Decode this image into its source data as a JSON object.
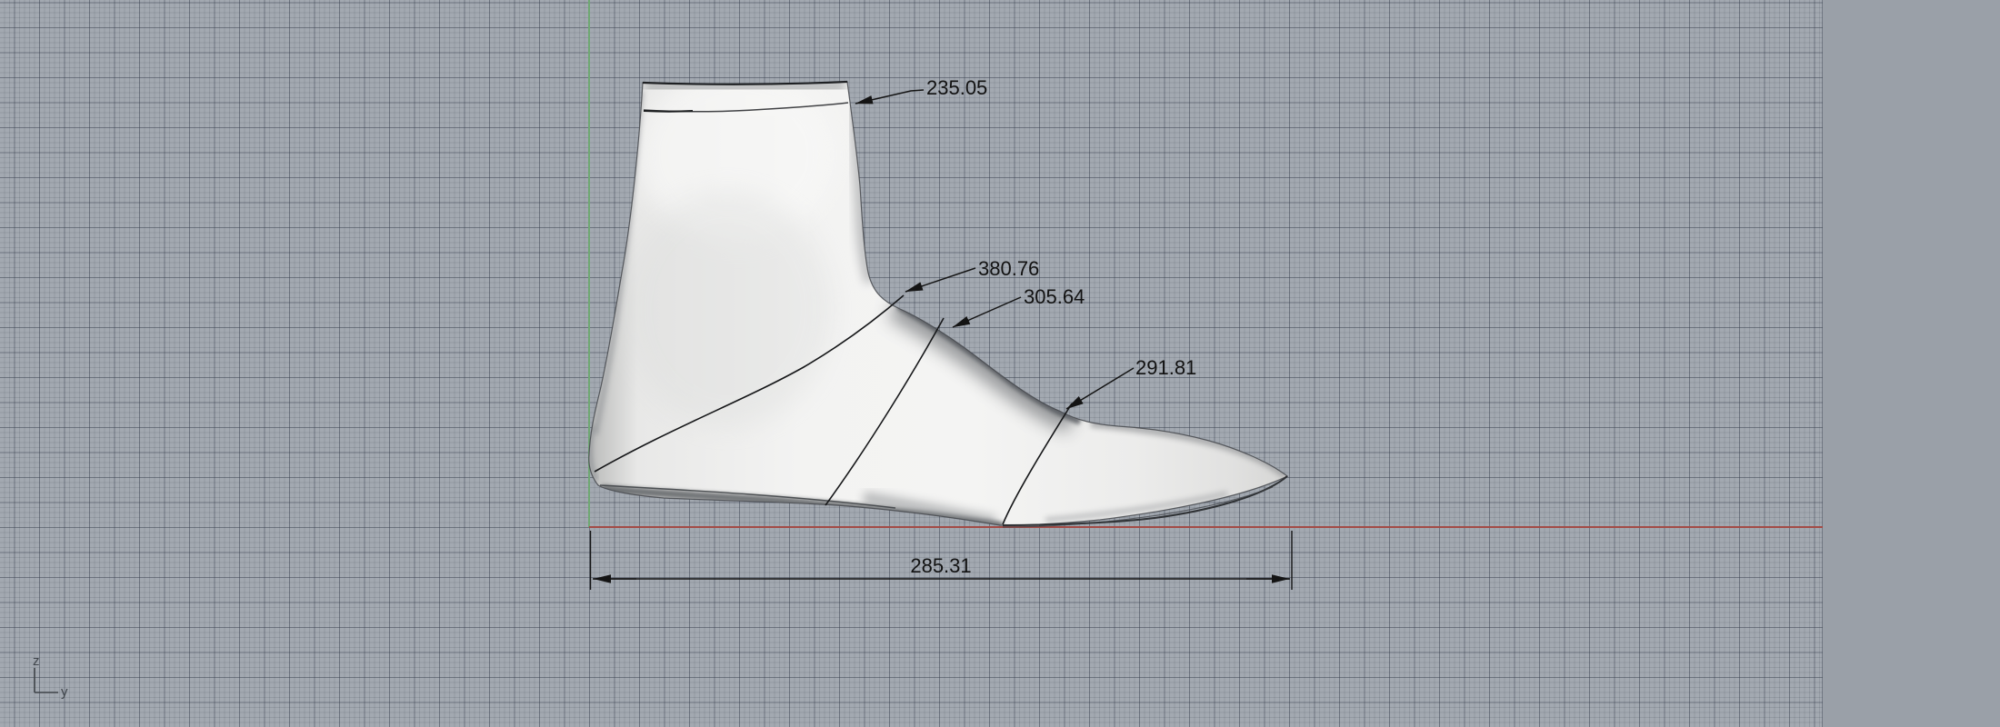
{
  "axis_gnomon": {
    "vertical_label": "z",
    "horizontal_label": "y"
  },
  "annotations": {
    "leaders": [
      {
        "value": "235.05"
      },
      {
        "value": "380.76"
      },
      {
        "value": "305.64"
      },
      {
        "value": "291.81"
      }
    ],
    "linear_dimension": {
      "value": "285.31"
    }
  },
  "colors": {
    "background": "#9aa0a8",
    "grid_background": "#a3a9b1",
    "grid_major_line": "#868c96",
    "grid_minor_line": "#99a0a8",
    "x_axis_red": "#a34b46",
    "z_axis_green": "#6fa873",
    "annotation_ink": "#141414",
    "model_surface": "#f2f2f1"
  }
}
